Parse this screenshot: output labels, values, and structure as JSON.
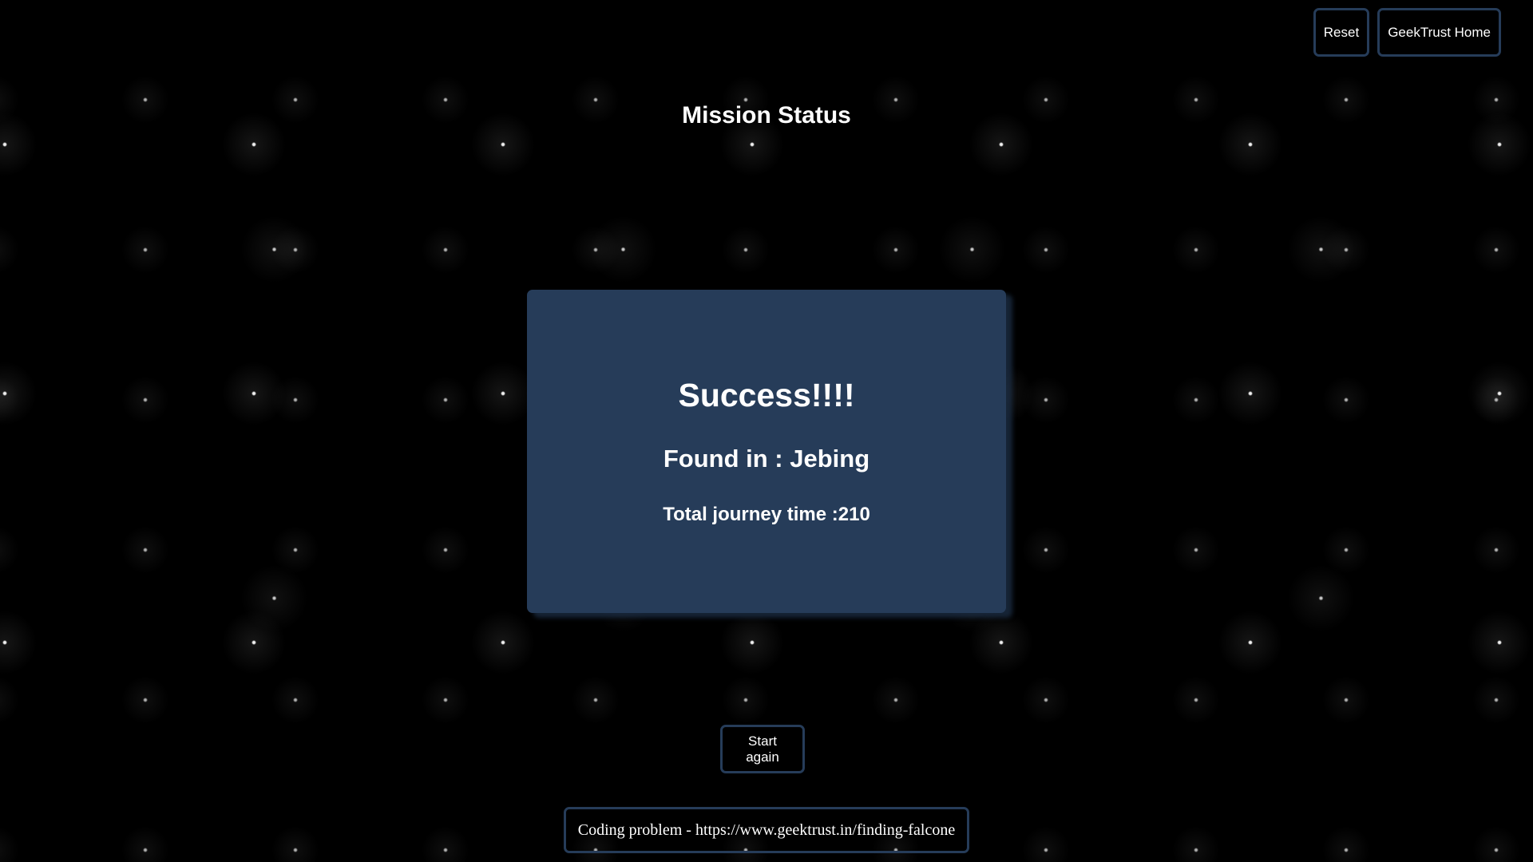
{
  "header": {
    "reset_label": "Reset",
    "home_label": "GeekTrust Home"
  },
  "page": {
    "title": "Mission Status"
  },
  "result": {
    "heading": "Success!!!!",
    "found_text": "Found in : Jebing",
    "journey_text": "Total journey time :210"
  },
  "actions": {
    "start_again_label": "Start again"
  },
  "footer": {
    "text": "Coding problem - https://www.geektrust.in/finding-falcone"
  },
  "colors": {
    "background": "#000000",
    "card": "#263c59",
    "border": "#263c59",
    "text": "#ffffff"
  }
}
